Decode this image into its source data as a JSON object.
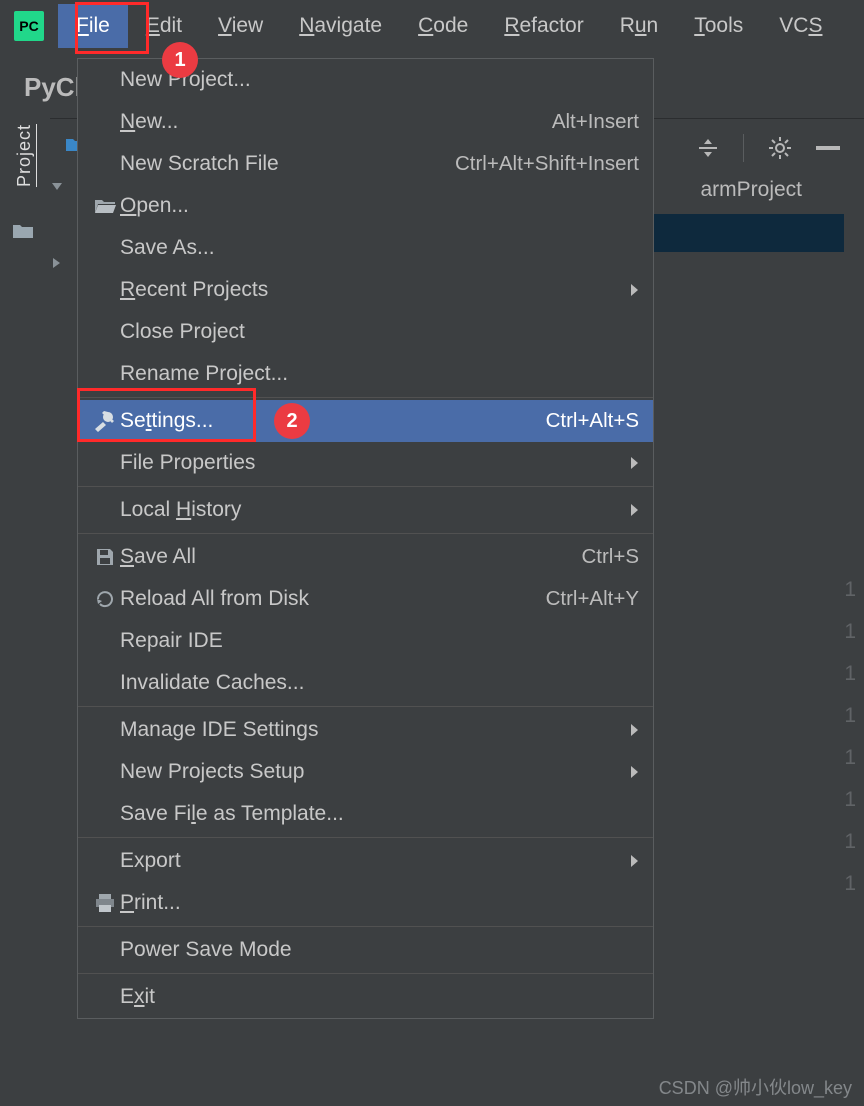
{
  "app": {
    "icon_text": "PC",
    "title_fragment": "PyCh"
  },
  "menubar": [
    {
      "label": "File",
      "mnemonic": "F",
      "active": true
    },
    {
      "label": "Edit",
      "mnemonic": "E"
    },
    {
      "label": "View",
      "mnemonic": "V"
    },
    {
      "label": "Navigate",
      "mnemonic": "N"
    },
    {
      "label": "Code",
      "mnemonic": "C"
    },
    {
      "label": "Refactor",
      "mnemonic": "R"
    },
    {
      "label": "Run",
      "mnemonic": "u"
    },
    {
      "label": "Tools",
      "mnemonic": "T"
    },
    {
      "label": "VCS",
      "mnemonic": "S"
    }
  ],
  "annotations": {
    "badge1": "1",
    "badge2": "2"
  },
  "sidebar": {
    "label": "Project"
  },
  "dropdown": {
    "groups": [
      [
        {
          "label": "New Project...",
          "icon": ""
        },
        {
          "label": "New...",
          "mnemonic": "N",
          "shortcut": "Alt+Insert"
        },
        {
          "label": "New Scratch File",
          "shortcut": "Ctrl+Alt+Shift+Insert"
        },
        {
          "label": "Open...",
          "mnemonic": "O",
          "icon": "open"
        },
        {
          "label": "Save As..."
        },
        {
          "label": "Recent Projects",
          "mnemonic": "R",
          "submenu": true
        },
        {
          "label": "Close Project"
        },
        {
          "label": "Rename Project..."
        }
      ],
      [
        {
          "label": "Settings...",
          "mnemonic": "t",
          "icon": "wrench",
          "shortcut": "Ctrl+Alt+S",
          "highlight": true
        },
        {
          "label": "File Properties",
          "submenu": true
        }
      ],
      [
        {
          "label": "Local History",
          "mnemonic": "H",
          "submenu": true
        }
      ],
      [
        {
          "label": "Save All",
          "mnemonic": "S",
          "icon": "save",
          "shortcut": "Ctrl+S"
        },
        {
          "label": "Reload All from Disk",
          "icon": "reload",
          "shortcut": "Ctrl+Alt+Y"
        },
        {
          "label": "Repair IDE"
        },
        {
          "label": "Invalidate Caches..."
        }
      ],
      [
        {
          "label": "Manage IDE Settings",
          "submenu": true
        },
        {
          "label": "New Projects Setup",
          "submenu": true
        },
        {
          "label": "Save File as Template...",
          "mnemonic": "l"
        }
      ],
      [
        {
          "label": "Export",
          "submenu": true
        },
        {
          "label": "Print...",
          "mnemonic": "P",
          "icon": "print"
        }
      ],
      [
        {
          "label": "Power Save Mode"
        }
      ],
      [
        {
          "label": "Exit",
          "mnemonic": "x"
        }
      ]
    ]
  },
  "right_path_fragment": "armProject",
  "gutter": [
    "1",
    "1",
    "1",
    "1",
    "1",
    "1",
    "1",
    "1"
  ],
  "watermark": "CSDN @帅小伙low_key"
}
